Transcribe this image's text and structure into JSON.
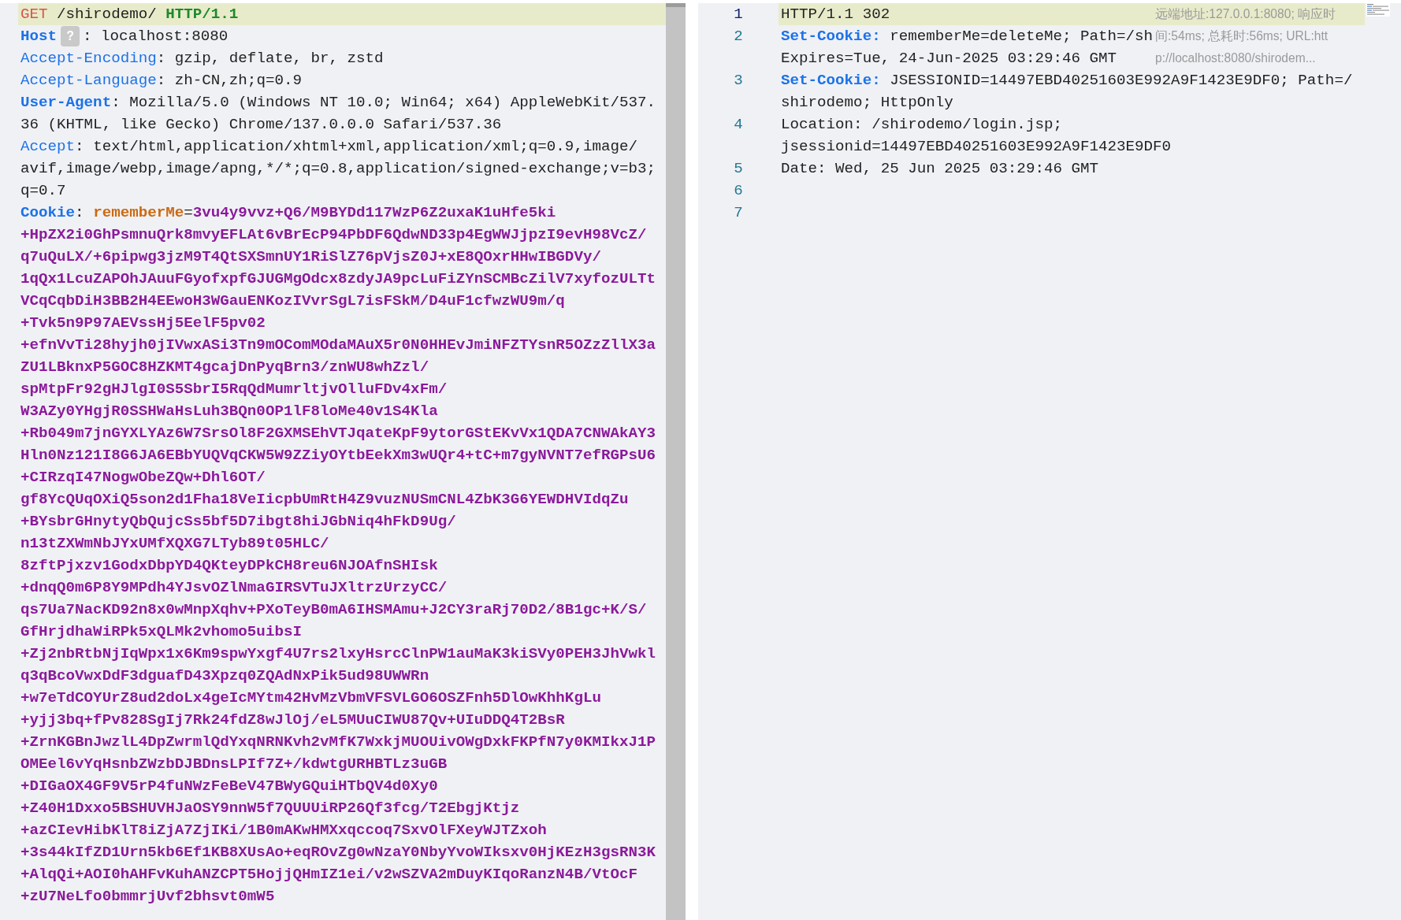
{
  "request": {
    "lines": [
      {
        "kind": "request_line",
        "current": true,
        "method": "GET",
        "target": "/shirodemo/",
        "version": "HTTP/1.1"
      },
      {
        "kind": "header",
        "current": false,
        "name": "Host",
        "bold": true,
        "badge": "?",
        "separator": ":",
        "value_rows": [
          "localhost:8080"
        ]
      },
      {
        "kind": "header",
        "current": false,
        "name": "Accept-Encoding",
        "bold": false,
        "separator": ":",
        "value_rows": [
          "gzip, deflate, br, zstd"
        ]
      },
      {
        "kind": "header",
        "current": false,
        "name": "Accept-Language",
        "bold": false,
        "separator": ":",
        "value_rows": [
          "zh-CN,zh;q=0.9"
        ]
      },
      {
        "kind": "header",
        "current": false,
        "name": "User-Agent",
        "bold": true,
        "separator": ":",
        "value_rows": [
          "Mozilla/5.0 (Windows NT 10.0; Win64; x64) AppleWebKit/537.",
          "36 (KHTML, like Gecko) Chrome/137.0.0.0 Safari/537.36"
        ]
      },
      {
        "kind": "header",
        "current": false,
        "name": "Accept",
        "bold": false,
        "separator": ":",
        "value_rows": [
          "text/html,application/xhtml+xml,application/xml;q=0.9,image/",
          "avif,image/webp,image/apng,*/*;q=0.8,application/signed-exchange;v=b3;",
          "q=0.7"
        ]
      },
      {
        "kind": "cookie",
        "current": false,
        "name": "Cookie",
        "bold": true,
        "separator": ":",
        "cookie_name": "rememberMe",
        "equals": "=",
        "value_rows": [
          "3vu4y9vvz+Q6/M9BYDd117WzP6Z2uxaK1uHfe5ki",
          "+HpZX2i0GhPsmnuQrk8mvyEFLAt6vBrEcP94PbDF6QdwND33p4EgWWJjpzI9evH98VcZ/",
          "q7uQuLX/+6pipwg3jzM9T4QtSXSmnUY1RiSlZ76pVjsZ0J+xE8QOxrHHwIBGDVy/",
          "1qQx1LcuZAPOhJAuuFGyofxpfGJUGMgOdcx8zdyJA9pcLuFiZYnSCMBcZilV7xyfozULTt",
          "VCqCqbDiH3BB2H4EEwoH3WGauENKozIVvrSgL7isFSkM/D4uF1cfwzWU9m/q",
          "+Tvk5n9P97AEVssHj5EelF5pv02",
          "+efnVvTi28hyjh0jIVwxASi3Tn9mOComMOdaMAuX5r0N0HHEvJmiNFZTYsnR5OZzZllX3a",
          "ZU1LBknxP5GOC8HZKMT4gcajDnPyqBrn3/znWU8whZzl/",
          "spMtpFr92gHJlgI0S5SbrI5RqQdMumrltjvOlluFDv4xFm/",
          "W3AZy0YHgjR0SSHWaHsLuh3BQn0OP1lF8loMe40v1S4Kla",
          "+Rb049m7jnGYXLYAz6W7SrsOl8F2GXMSEhVTJqateKpF9ytorGStEKvVx1QDA7CNWAkAY3",
          "Hln0Nz121I8G6JA6EBbYUQVqCKW5W9ZZiyOYtbEekXm3wUQr4+tC+m7gyNVNT7efRGPsU6",
          "+CIRzqI47NogwObeZQw+Dhl6OT/",
          "gf8YcQUqOXiQ5son2d1Fha18VeIicpbUmRtH4Z9vuzNUSmCNL4ZbK3G6YEWDHVIdqZu",
          "+BYsbrGHnytyQbQujcSs5bf5D7ibgt8hiJGbNiq4hFkD9Ug/",
          "n13tZXWmNbJYxUMfXQXG7LTyb89t05HLC/",
          "8zftPjxzv1GodxDbpYD4QKteyDPkCH8reu6NJOAfnSHIsk",
          "+dnqQ0m6P8Y9MPdh4YJsvOZlNmaGIRSVTuJXltrzUrzyCC/",
          "qs7Ua7NacKD92n8x0wMnpXqhv+PXoTeyB0mA6IHSMAmu+J2CY3raRj70D2/8B1gc+K/S/",
          "GfHrjdhaWiRPk5xQLMk2vhomo5uibsI",
          "+Zj2nbRtbNjIqWpx1x6Km9spwYxgf4U7rs2lxyHsrcClnPW1auMaK3kiSVy0PEH3JhVwkl",
          "q3qBcoVwxDdF3dguafD43Xpzq0ZQAdNxPik5ud98UWWRn",
          "+w7eTdCOYUrZ8ud2doLx4geIcMYtm42HvMzVbmVFSVLGO6OSZFnh5DlOwKhhKgLu",
          "+yjj3bq+fPv828SgIj7Rk24fdZ8wJlOj/eL5MUuCIWU87Qv+UIuDDQ4T2BsR",
          "+ZrnKGBnJwzlL4DpZwrmlQdYxqNRNKvh2vMfK7WxkjMUOUivOWgDxkFKPfN7y0KMIkxJ1P",
          "OMEel6vYqHsnbZWzbDJBDnsLPIf7Z+/kdwtgURHBTLz3uGB",
          "+DIGaOX4GF9V5rP4fuNWzFeBeV47BWyGQuiHTbQV4d0Xy0",
          "+Z40H1Dxxo5BSHUVHJaOSY9nnW5f7QUUUiRP26Qf3fcg/T2EbgjKtjz",
          "+azCIevHibKlT8iZjA7ZjIKi/1B0mAKwHMXxqccoq7SxvOlFXeyWJTZxoh",
          "+3s44kIfZD1Urn5kb6Ef1KB8XUsAo+eqROvZg0wNzaY0NbyYvoWIksxv0HjKEzH3gsRN3K",
          "+AlqQi+AOI0hAHFvKuhANZCPT5HojjQHmIZ1ei/v2wSZVA2mDuyKIqoRanzN4B/VtOcF",
          "+zU7NeLfo0bmmrjUvf2bhsvt0mW5"
        ]
      }
    ]
  },
  "response": {
    "lines": [
      {
        "number": "1",
        "current": true,
        "kind": "status",
        "rows": [
          "HTTP/1.1 302"
        ]
      },
      {
        "number": "2",
        "current": false,
        "kind": "header",
        "name": "Set-Cookie:",
        "rows": [
          "rememberMe=deleteMe; Path=/sh",
          "Expires=Tue, 24-Jun-2025 03:29:46 GMT"
        ]
      },
      {
        "number": "3",
        "current": false,
        "kind": "header",
        "name": "Set-Cookie:",
        "rows": [
          "JSESSIONID=14497EBD40251603E992A9F1423E9DF0; Path=/",
          "shirodemo; HttpOnly"
        ]
      },
      {
        "number": "4",
        "current": false,
        "kind": "plain",
        "rows": [
          "Location: /shirodemo/login.jsp;",
          "jsessionid=14497EBD40251603E992A9F1423E9DF0"
        ]
      },
      {
        "number": "5",
        "current": false,
        "kind": "plain",
        "rows": [
          "Date: Wed, 25 Jun 2025 03:29:46 GMT"
        ]
      },
      {
        "number": "6",
        "current": false,
        "kind": "blank"
      },
      {
        "number": "7",
        "current": false,
        "kind": "blank"
      }
    ],
    "info_rows": [
      "远端地址:127.0.0.1:8080; 响应时",
      "间:54ms; 总耗时:56ms; URL:htt",
      "p://localhost:8080/shirodem..."
    ]
  }
}
